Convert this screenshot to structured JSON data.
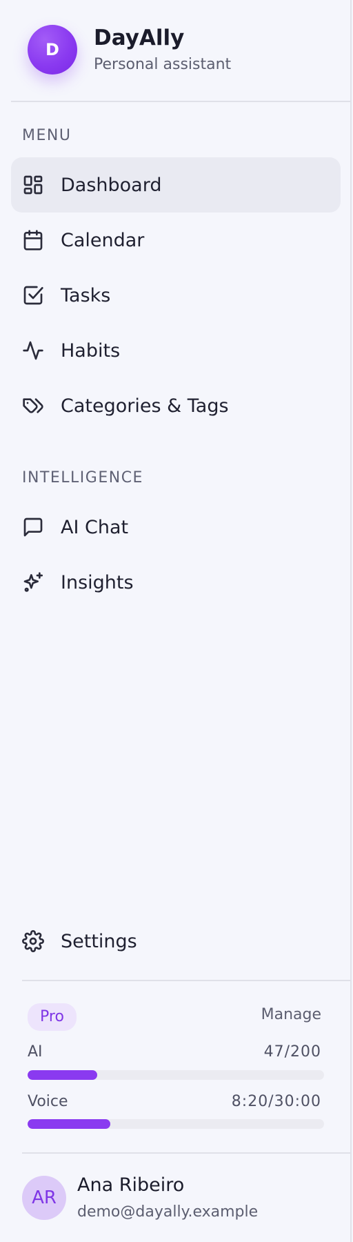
{
  "brand": {
    "logo_letter": "D",
    "name": "DayAlly",
    "subtitle": "Personal assistant"
  },
  "sections": {
    "menu_label": "MENU",
    "intelligence_label": "INTELLIGENCE"
  },
  "menu": [
    {
      "label": "Dashboard",
      "icon": "dashboard-grid-icon",
      "active": true
    },
    {
      "label": "Calendar",
      "icon": "calendar-icon",
      "active": false
    },
    {
      "label": "Tasks",
      "icon": "checkbox-icon",
      "active": false
    },
    {
      "label": "Habits",
      "icon": "activity-pulse-icon",
      "active": false
    },
    {
      "label": "Categories & Tags",
      "icon": "tags-icon",
      "active": false
    }
  ],
  "intelligence": [
    {
      "label": "AI Chat",
      "icon": "chat-bubble-icon"
    },
    {
      "label": "Insights",
      "icon": "sparkles-icon"
    }
  ],
  "settings": {
    "label": "Settings",
    "icon": "gear-icon"
  },
  "plan": {
    "badge": "Pro",
    "manage_label": "Manage",
    "usage": [
      {
        "label": "AI",
        "value": "47/200",
        "fraction": 0.235
      },
      {
        "label": "Voice",
        "value": "8:20/30:00",
        "fraction": 0.278
      }
    ]
  },
  "user": {
    "initials": "AR",
    "name": "Ana Ribeiro",
    "email": "demo@dayally.example"
  },
  "colors": {
    "accent": "#8a3af0",
    "background": "#f5f6fc",
    "active_item_bg": "#e9eaf2"
  }
}
